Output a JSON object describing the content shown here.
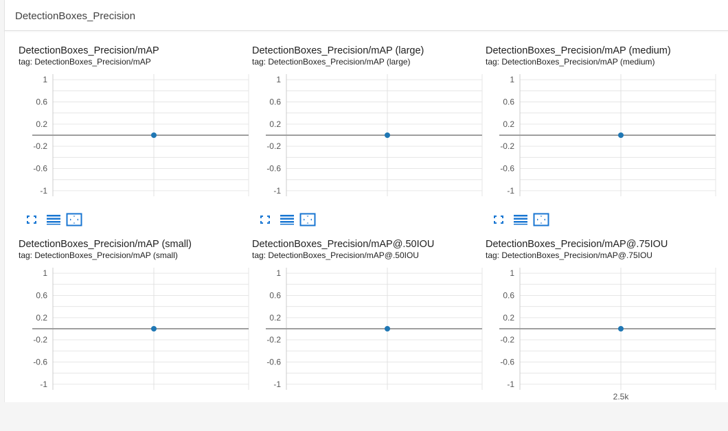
{
  "section": {
    "title": "DetectionBoxes_Precision"
  },
  "colors": {
    "accent": "#1976d2",
    "point": "#1f77b4",
    "zero_line": "#9e9e9e",
    "grid": "#e0e0e0"
  },
  "toolbar_icons": [
    "fullscreen-icon",
    "data-table-icon",
    "fit-domain-icon"
  ],
  "charts": [
    {
      "title": "DetectionBoxes_Precision/mAP",
      "tag": "tag: DetectionBoxes_Precision/mAP"
    },
    {
      "title": "DetectionBoxes_Precision/mAP (large)",
      "tag": "tag: DetectionBoxes_Precision/mAP (large)"
    },
    {
      "title": "DetectionBoxes_Precision/mAP (medium)",
      "tag": "tag: DetectionBoxes_Precision/mAP (medium)"
    },
    {
      "title": "DetectionBoxes_Precision/mAP (small)",
      "tag": "tag: DetectionBoxes_Precision/mAP (small)"
    },
    {
      "title": "DetectionBoxes_Precision/mAP@.50IOU",
      "tag": "tag: DetectionBoxes_Precision/mAP@.50IOU"
    },
    {
      "title": "DetectionBoxes_Precision/mAP@.75IOU",
      "tag": "tag: DetectionBoxes_Precision/mAP@.75IOU"
    }
  ],
  "chart_data": [
    {
      "type": "scatter",
      "title": "DetectionBoxes_Precision/mAP",
      "x": [
        2500
      ],
      "y": [
        0
      ],
      "ylim": [
        -1.1,
        1.1
      ],
      "yticks": [
        "1",
        "0.6",
        "0.2",
        "-0.2",
        "-0.6",
        "-1"
      ],
      "xticks": []
    },
    {
      "type": "scatter",
      "title": "DetectionBoxes_Precision/mAP (large)",
      "x": [
        2500
      ],
      "y": [
        0
      ],
      "ylim": [
        -1.1,
        1.1
      ],
      "yticks": [
        "1",
        "0.6",
        "0.2",
        "-0.2",
        "-0.6",
        "-1"
      ],
      "xticks": []
    },
    {
      "type": "scatter",
      "title": "DetectionBoxes_Precision/mAP (medium)",
      "x": [
        2500
      ],
      "y": [
        0
      ],
      "ylim": [
        -1.1,
        1.1
      ],
      "yticks": [
        "1",
        "0.6",
        "0.2",
        "-0.2",
        "-0.6",
        "-1"
      ],
      "xticks": []
    },
    {
      "type": "scatter",
      "title": "DetectionBoxes_Precision/mAP (small)",
      "x": [
        2500
      ],
      "y": [
        0
      ],
      "ylim": [
        -1.1,
        1.1
      ],
      "yticks": [
        "1",
        "0.6",
        "0.2",
        "-0.2",
        "-0.6",
        "-1"
      ],
      "xticks": []
    },
    {
      "type": "scatter",
      "title": "DetectionBoxes_Precision/mAP@.50IOU",
      "x": [
        2500
      ],
      "y": [
        0
      ],
      "ylim": [
        -1.1,
        1.1
      ],
      "yticks": [
        "1",
        "0.6",
        "0.2",
        "-0.2",
        "-0.6",
        "-1"
      ],
      "xticks": []
    },
    {
      "type": "scatter",
      "title": "DetectionBoxes_Precision/mAP@.75IOU",
      "x": [
        2500
      ],
      "y": [
        0
      ],
      "ylim": [
        -1.1,
        1.1
      ],
      "yticks": [
        "1",
        "0.6",
        "0.2",
        "-0.2",
        "-0.6",
        "-1"
      ],
      "xticks": [
        "2.5k"
      ]
    }
  ]
}
